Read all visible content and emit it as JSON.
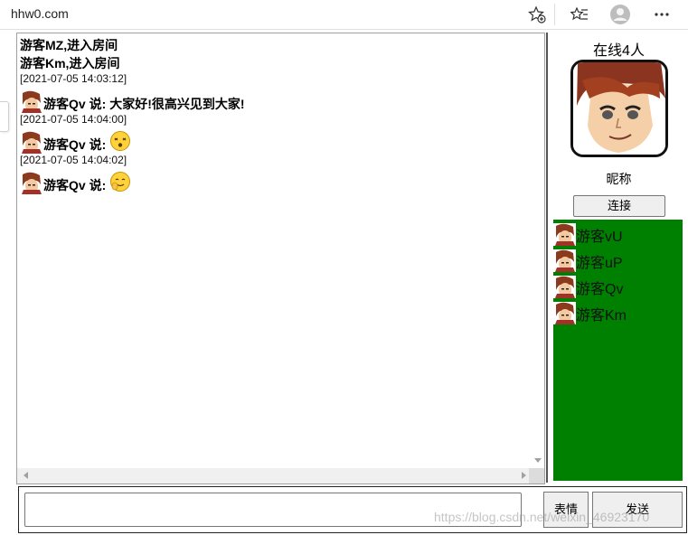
{
  "browser": {
    "url": "hhw0.com",
    "icons": [
      "add-favorite-icon",
      "favorites-icon",
      "profile-icon",
      "more-icon"
    ]
  },
  "chat": {
    "system_messages": [
      "游客MZ,进入房间",
      "游客Km,进入房间"
    ],
    "messages": [
      {
        "timestamp": "[2021-07-05 14:03:12]",
        "speaker": "游客Qv 说:",
        "text": "大家好!很高兴见到大家!",
        "emoji": null
      },
      {
        "timestamp": "[2021-07-05 14:04:00]",
        "speaker": "游客Qv 说:",
        "text": "",
        "emoji": "dizzy-face-emoji"
      },
      {
        "timestamp": "[2021-07-05 14:04:02]",
        "speaker": "游客Qv 说:",
        "text": "",
        "emoji": "waving-hand-face-emoji"
      }
    ]
  },
  "panel": {
    "online_count_label": "在线4人",
    "nickname_label": "昵称",
    "connect_label": "连接",
    "users": [
      "游客vU",
      "游客uP",
      "游客Qv",
      "游客Km"
    ],
    "list_background": "#008000"
  },
  "input": {
    "value": "",
    "emoji_button_label": "表情",
    "send_button_label": "发送"
  },
  "watermark": "https://blog.csdn.net/weixin_46923170"
}
